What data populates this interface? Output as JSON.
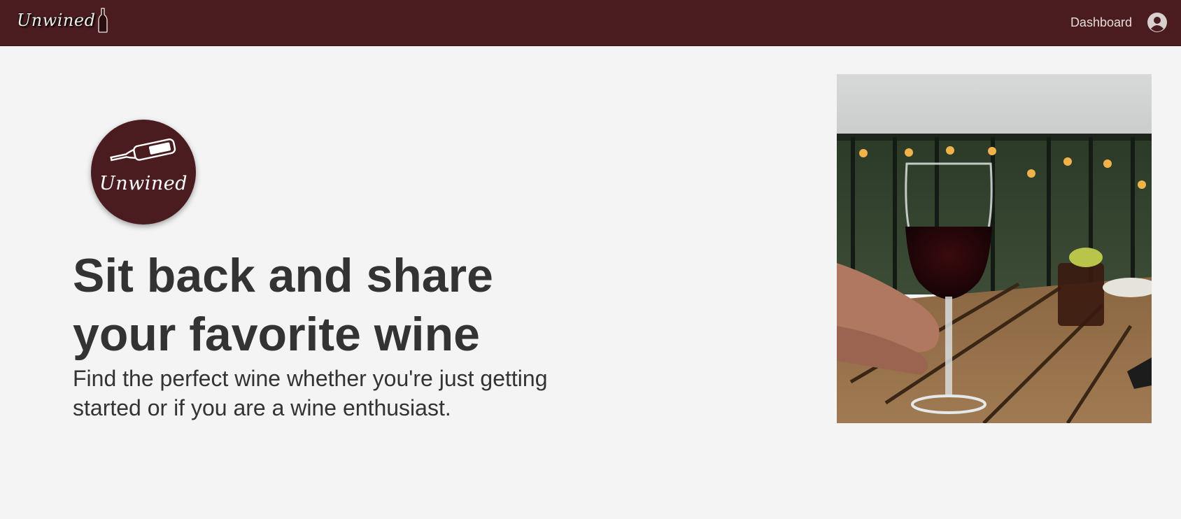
{
  "navbar": {
    "brand_text": "Unwined",
    "dashboard_label": "Dashboard",
    "background": "#4a1c1f"
  },
  "hero": {
    "logo_text": "Unwined",
    "headline": "Sit back and share your favorite wine",
    "subline": "Find the perfect wine whether you're just getting started or if you are a wine enthusiast.",
    "photo_subject": "glass of red wine on wooden table"
  },
  "icons": {
    "user": "user-circle-icon",
    "bottle": "wine-bottle-icon"
  }
}
